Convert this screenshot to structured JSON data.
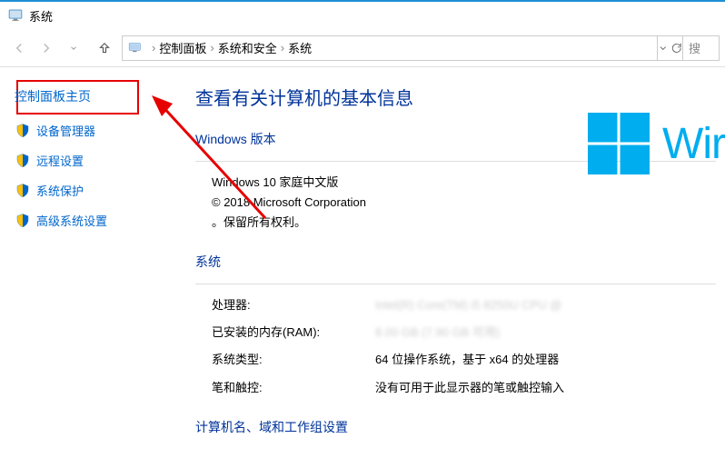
{
  "titlebar": {
    "title": "系统"
  },
  "breadcrumb": {
    "items": [
      "控制面板",
      "系统和安全",
      "系统"
    ],
    "search_placeholder": "搜"
  },
  "sidebar": {
    "home": "控制面板主页",
    "links": [
      "设备管理器",
      "远程设置",
      "系统保护",
      "高级系统设置"
    ]
  },
  "main": {
    "heading": "查看有关计算机的基本信息",
    "windows_edition_title": "Windows 版本",
    "windows_edition_name": "Windows 10 家庭中文版",
    "copyright_line1": "© 2018 Microsoft Corporation",
    "copyright_line2": "。保留所有权利。",
    "brand_text": "Wir",
    "system_title": "系统",
    "rows": {
      "processor_label": "处理器:",
      "processor_value": "Intel(R) Core(TM) i5 8250U CPU @",
      "ram_label": "已安装的内存(RAM):",
      "ram_value": "8.00 GB (7.90 GB 可用)",
      "systype_label": "系统类型:",
      "systype_value": "64 位操作系统，基于 x64 的处理器",
      "pen_label": "笔和触控:",
      "pen_value": "没有可用于此显示器的笔或触控输入"
    },
    "footer_section": "计算机名、域和工作组设置"
  }
}
